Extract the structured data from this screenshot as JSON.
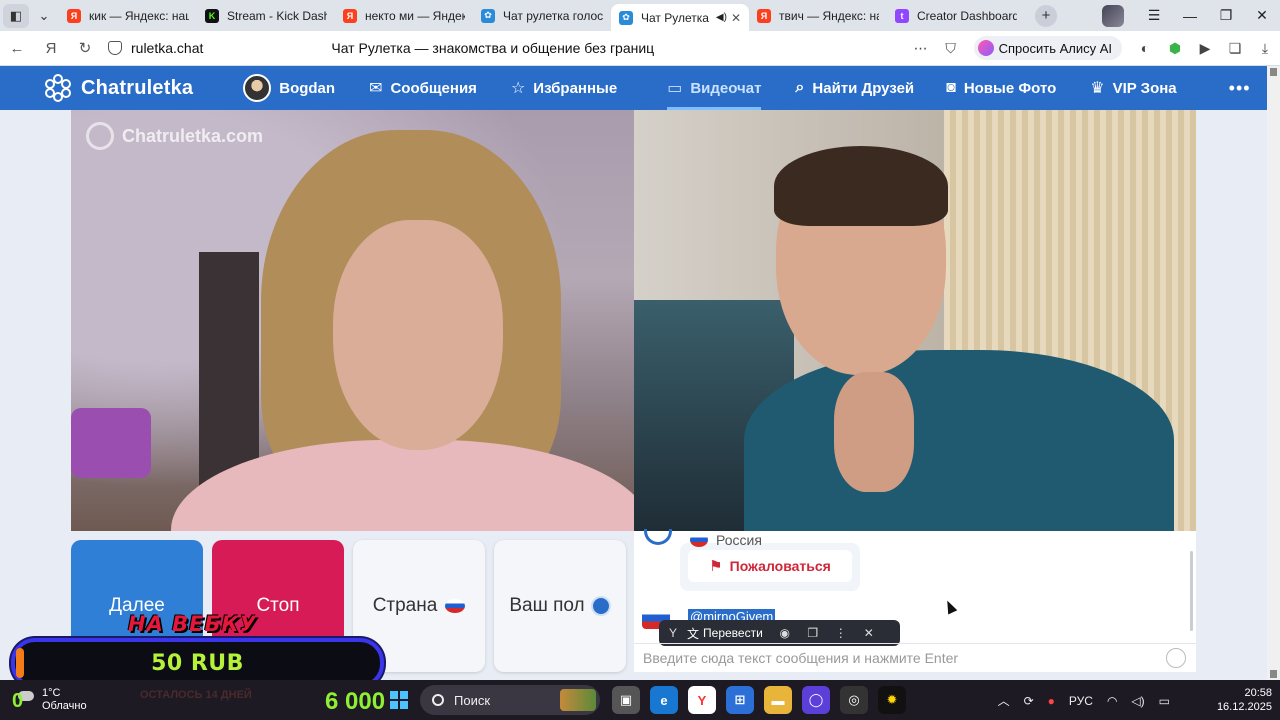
{
  "browser": {
    "tabs": [
      {
        "title": "кик — Яндекс: наш",
        "favicon": "yandex-icon",
        "active": false
      },
      {
        "title": "Stream - Kick Dashb",
        "favicon": "kick-icon",
        "active": false
      },
      {
        "title": "некто ми — Яндекс",
        "favicon": "yandex-icon",
        "active": false
      },
      {
        "title": "Чат рулетка голосо",
        "favicon": "chat-icon",
        "active": false
      },
      {
        "title": "Чат Рулетка –",
        "favicon": "chat-icon",
        "active": true
      },
      {
        "title": "твич — Яндекс: наш",
        "favicon": "yandex-icon",
        "active": false
      },
      {
        "title": "Creator Dashboard",
        "favicon": "twitch-icon",
        "active": false
      }
    ],
    "url": "ruletka.chat",
    "page_title": "Чат Рулетка — знакомства и общение без границ",
    "alice_label": "Спросить Алису AI"
  },
  "site": {
    "logo": "Chatruletka",
    "user_name": "Bogdan",
    "nav": [
      {
        "label": "Сообщения",
        "icon": "envelope-icon"
      },
      {
        "label": "Избранные",
        "icon": "star-icon"
      },
      {
        "label": "Видеочат",
        "icon": "video-camera-icon",
        "active": true
      },
      {
        "label": "Найти Друзей",
        "icon": "search-icon"
      },
      {
        "label": "Новые Фото",
        "icon": "camera-icon"
      },
      {
        "label": "VIP Зона",
        "icon": "crown-icon"
      }
    ],
    "more": "•••",
    "watermark": "Chatruletka.com"
  },
  "controls": {
    "next": "Далее",
    "stop": "Стоп",
    "country": "Страна",
    "gender": "Ваш пол"
  },
  "chat": {
    "partner_country": "Россия",
    "report_label": "Пожаловаться",
    "mention": "@mirnoGivem",
    "translate_label": "Перевести",
    "input_placeholder": "Введите сюда текст сообщения и нажмите Enter"
  },
  "overlay": {
    "promo_title": "НА ВЕБКУ",
    "promo_amount": "50 RUB",
    "promo_sub": "ОСТАЛОСЬ 14 ДНЕЙ",
    "donate_left": "0",
    "donate_total": "6 000"
  },
  "taskbar": {
    "temperature": "1°C",
    "weather": "Облачно",
    "search": "Поиск",
    "language": "РУС",
    "time": "20:58",
    "date": "16.12.2025"
  },
  "colors": {
    "brand": "#2a6dc9",
    "next_button": "#2f7fd6",
    "stop_button": "#d61b57",
    "report_text": "#d0263a"
  }
}
